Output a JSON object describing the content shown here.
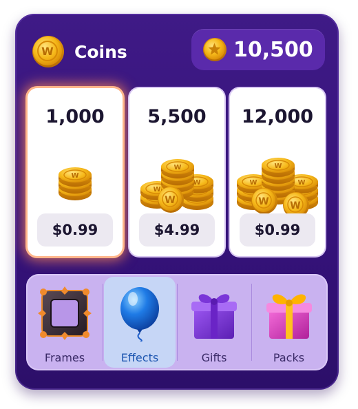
{
  "header": {
    "title": "Coins",
    "balance": "10,500"
  },
  "offers": [
    {
      "amount": "1,000",
      "price": "$0.99",
      "featured": true
    },
    {
      "amount": "5,500",
      "price": "$4.99",
      "featured": false
    },
    {
      "amount": "12,000",
      "price": "$0.99",
      "featured": false
    }
  ],
  "tabs": [
    {
      "label": "Frames",
      "icon": "frame-icon",
      "active": false
    },
    {
      "label": "Effects",
      "icon": "balloon-icon",
      "active": true
    },
    {
      "label": "Gifts",
      "icon": "gift-icon",
      "active": false
    },
    {
      "label": "Packs",
      "icon": "gift-pack-icon",
      "active": false
    }
  ],
  "colors": {
    "panel": "#3f1a86",
    "coin": "#f5b80f",
    "featured_glow": "#ff8a54",
    "active_tab_text": "#1d56b0"
  }
}
